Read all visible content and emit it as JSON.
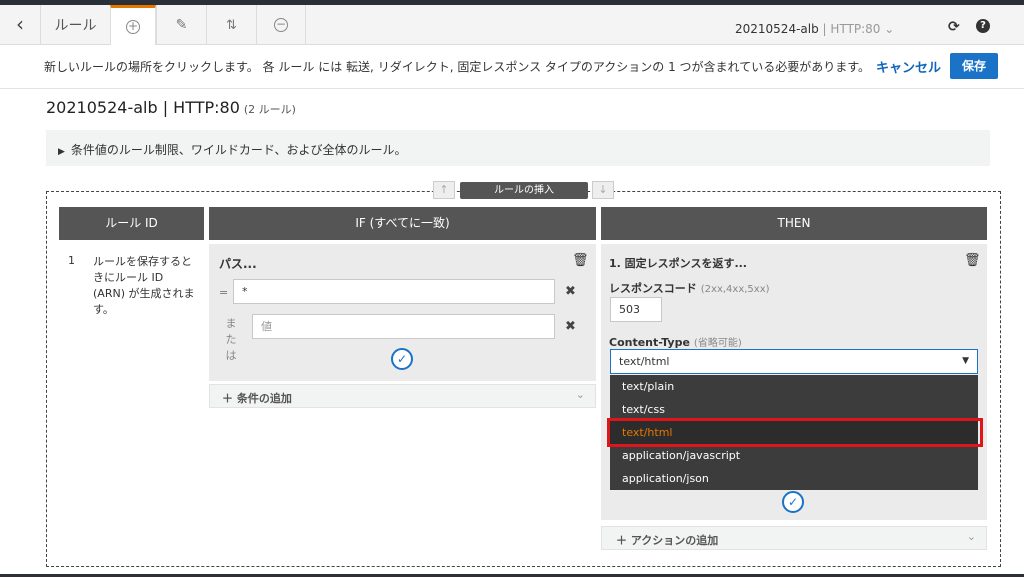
{
  "toolbar": {
    "back_icon": "chevron-left-icon",
    "rules_label": "ルール",
    "add_icon": "plus-circle-icon",
    "edit_icon": "pencil-icon",
    "reorder_icon": "reorder-arrows-icon",
    "delete_icon": "minus-circle-icon",
    "lb_name": "20210524-alb",
    "lb_separator": "|",
    "lb_listener": "HTTP:80",
    "refresh_icon": "refresh-icon",
    "help_icon": "help-icon"
  },
  "instruction": {
    "text": "新しいルールの場所をクリックします。 各 ルール には 転送, リダイレクト, 固定レスポンス タイプのアクションの 1 つが含まれている必要があります。",
    "cancel_label": "キャンセル",
    "save_label": "保存"
  },
  "page": {
    "title": "20210524-alb | HTTP:80",
    "rule_count": "(2 ルール)",
    "info_text": "条件値のルール制限、ワイルドカード、および全体のルール。"
  },
  "insert": {
    "label": "ルールの挿入"
  },
  "columns": {
    "rule_id": "ルール ID",
    "if": "IF (すべてに一致)",
    "then": "THEN"
  },
  "rule": {
    "number": "1",
    "id_note": "ルールを保存するときにルール ID (ARN) が生成されます。"
  },
  "condition": {
    "title": "パス...",
    "eq_label": "=",
    "value": "*",
    "or_label": "または",
    "or_placeholder": "値",
    "add_label": "条件の追加"
  },
  "action": {
    "title": "1. 固定レスポンスを返す...",
    "response_code_label": "レスポンスコード",
    "response_code_hint": "(2xx,4xx,5xx)",
    "response_code_value": "503",
    "content_type_label": "Content-Type",
    "content_type_hint": "(省略可能)",
    "content_type_value": "text/html",
    "options": [
      "text/plain",
      "text/css",
      "text/html",
      "application/javascript",
      "application/json"
    ],
    "add_label": "アクションの追加"
  },
  "colors": {
    "accent_orange": "#e77600",
    "primary_blue": "#1a73c7",
    "highlight_red": "#e0151a"
  }
}
